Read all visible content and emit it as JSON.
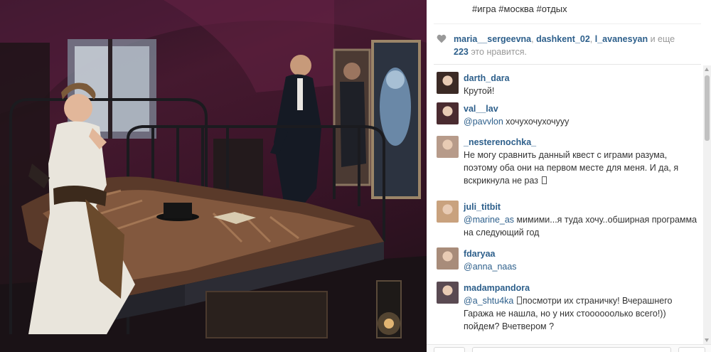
{
  "post": {
    "photo_alt": "Квест: девушка в белом платье на кровати, мужчина у зеркала, призрак в отражении",
    "caption_tags": "#игра #москва #отдых"
  },
  "likes": {
    "users": [
      "maria__sergeevna",
      "dashkent_02",
      "l_avanesyan"
    ],
    "sep": ", ",
    "and_more": " и еще",
    "count": "223",
    "suffix": " это нравится."
  },
  "comments": [
    {
      "user": "darth_dara",
      "parts": [
        {
          "t": "Крутой!"
        }
      ]
    },
    {
      "user": "val__lav",
      "parts": [
        {
          "t": "@pavvlon",
          "m": true
        },
        {
          "t": " хочухочухочууу"
        }
      ]
    },
    {
      "user": "_nesterenochka_",
      "parts": [
        {
          "t": "Не могу сравнить данный квест с играми разума, поэтому оба они на первом месте для меня. И да, я вскрикнула не раз "
        },
        {
          "g": true
        }
      ]
    },
    {
      "user": "juli_titbit",
      "parts": [
        {
          "t": "@marine_as",
          "m": true
        },
        {
          "t": " мимими...я туда хочу..обширная программа на следующий год"
        }
      ]
    },
    {
      "user": "fdaryaa",
      "parts": [
        {
          "t": "@anna_naas",
          "m": true
        }
      ]
    },
    {
      "user": "madampandora",
      "parts": [
        {
          "t": "@a_shtu4ka",
          "m": true
        },
        {
          "t": " "
        },
        {
          "g": true
        },
        {
          "t": "посмотри их страничку! Вчерашнего Гаража не нашла, но у них стоооооолько всего!)) пойдем? Вчетвером ?"
        }
      ]
    }
  ],
  "avatars": [
    "#3b2a25",
    "#4a2b30",
    "#b79b8a",
    "#c9a27e",
    "#a88c7a",
    "#5a4a52"
  ],
  "colors": {
    "accent": "#2d5f8b",
    "text": "#333333",
    "muted": "#999999"
  }
}
